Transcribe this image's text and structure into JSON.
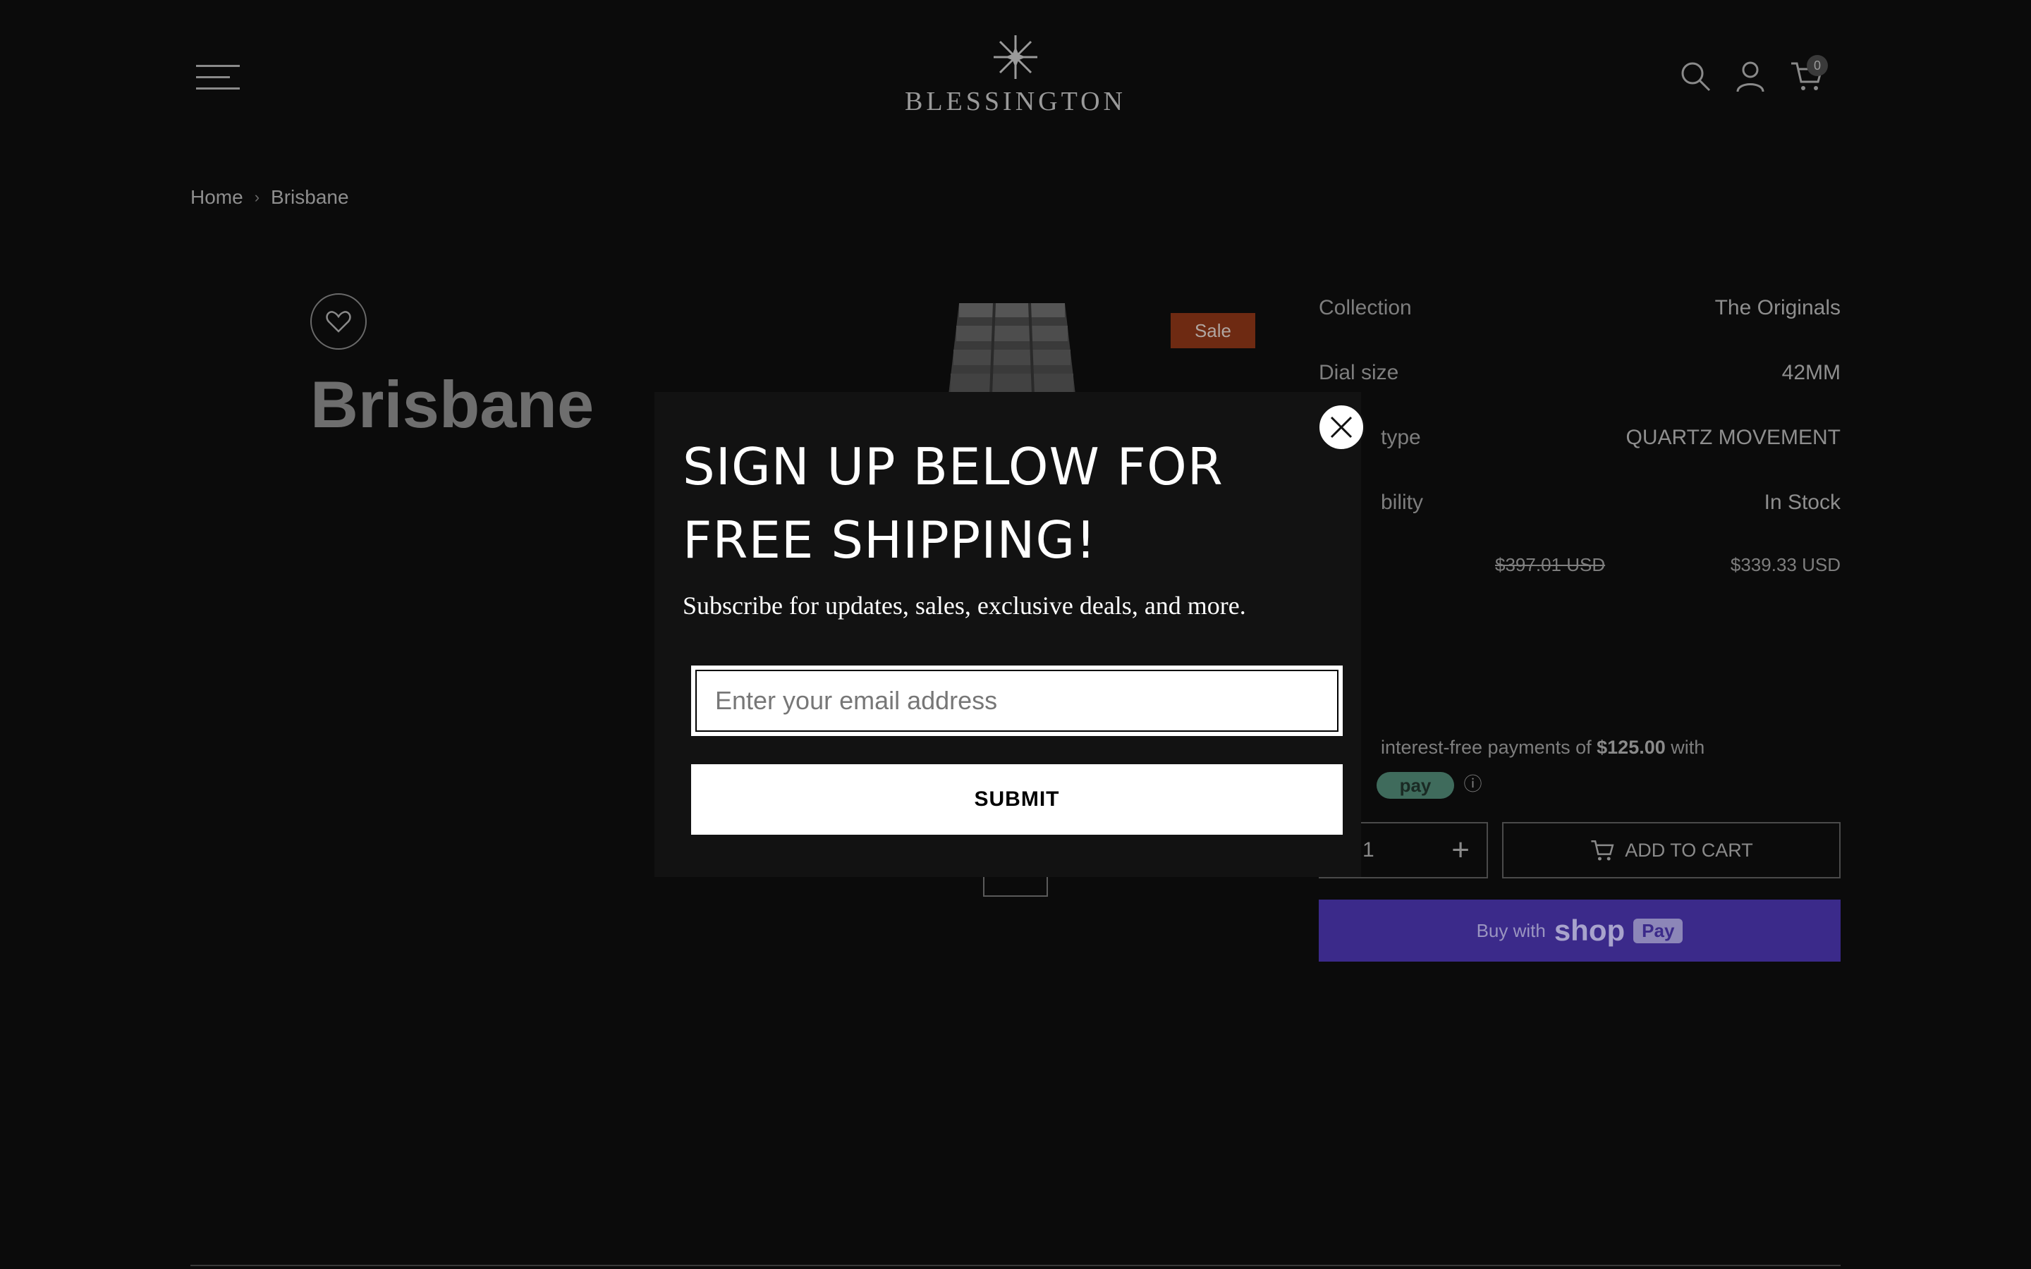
{
  "header": {
    "brand": "BLESSINGTON",
    "cart_count": "0",
    "icons": [
      "menu-icon",
      "search-icon",
      "account-icon",
      "cart-icon"
    ]
  },
  "breadcrumb": {
    "home": "Home",
    "current": "Brisbane"
  },
  "product": {
    "title": "Brisbane",
    "badge": "Sale",
    "specs": [
      {
        "label": "Collection",
        "value": "The Originals"
      },
      {
        "label": "Dial size",
        "value": "42MM"
      },
      {
        "label": "type",
        "value": "QUARTZ MOVEMENT"
      },
      {
        "label": "bility",
        "value": "In Stock"
      }
    ],
    "price_old": "$397.01 USD",
    "price_new": "$339.33 USD",
    "afterpay_prefix": "interest-free payments of ",
    "afterpay_amount": "$125.00",
    "afterpay_suffix": " with",
    "afterpay_logo": "pay",
    "quantity": "1",
    "add_to_cart": "ADD TO CART",
    "buy_with": "Buy with",
    "shop": "shop",
    "pay": "Pay"
  },
  "popup": {
    "title": "SIGN UP BELOW FOR FREE SHIPPING!",
    "subtitle": "Subscribe for updates, sales, exclusive deals, and more.",
    "email_placeholder": "Enter your email address",
    "submit_label": "SUBMIT"
  },
  "colors": {
    "background": "#0b0b0b",
    "sale_badge": "#6e2a12",
    "shop_pay": "#3b2a8a",
    "popup_bg": "#121212"
  }
}
